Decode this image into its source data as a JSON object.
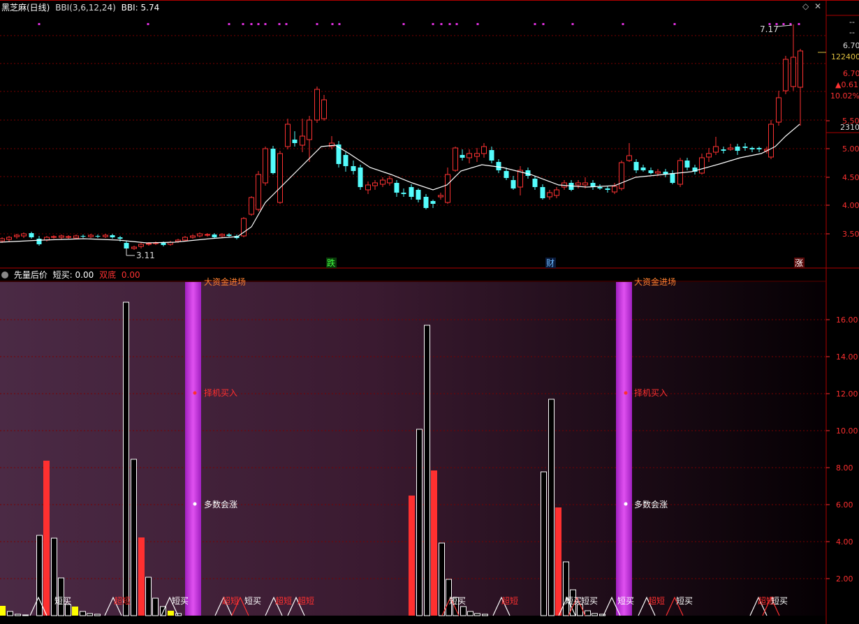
{
  "top_header": {
    "stock_name": "黑芝麻(日线)",
    "indicator": "BBI(3,6,12,24)",
    "indicator_value": "BBI: 5.74"
  },
  "bottom_header": {
    "indicator_name": "先量后价",
    "short_buy": "短买: 0.00",
    "double_bottom": "双底",
    "double_bottom_value": "0.00"
  },
  "window_controls": {
    "diamond": "◇",
    "close": "✕"
  },
  "top_axis": {
    "dash1": "--",
    "dash2": "--",
    "price_670_a": "6.70",
    "volume": "122400",
    "price_670_b": "6.70",
    "change": "▲0.61",
    "change_pct": "10.02%",
    "turnover": "2310",
    "ticks": [
      "5.50",
      "5.00",
      "4.50",
      "4.00",
      "3.50"
    ]
  },
  "bottom_axis": {
    "ticks": [
      "16.00",
      "14.00",
      "12.00",
      "10.00",
      "8.00",
      "6.00",
      "4.00",
      "2.00"
    ]
  },
  "annotations": {
    "high": "7.17",
    "low": "3.11",
    "event_die": "跌",
    "event_cai": "财",
    "event_zhang": "涨"
  },
  "signals": {
    "big_money": "大资金进场",
    "choose_buy": "择机买入",
    "mostly_rise": "多数会涨",
    "short_buy": "短买",
    "super_short": "超短"
  },
  "colors": {
    "up": "#ff3232",
    "down": "#54fcfc",
    "bbi": "#ffffff",
    "grid": "#7a0000",
    "magenta": "#e030e0",
    "yellow": "#ffff00",
    "signal_red": "#ff3030",
    "signal_white": "#ffffff"
  }
}
